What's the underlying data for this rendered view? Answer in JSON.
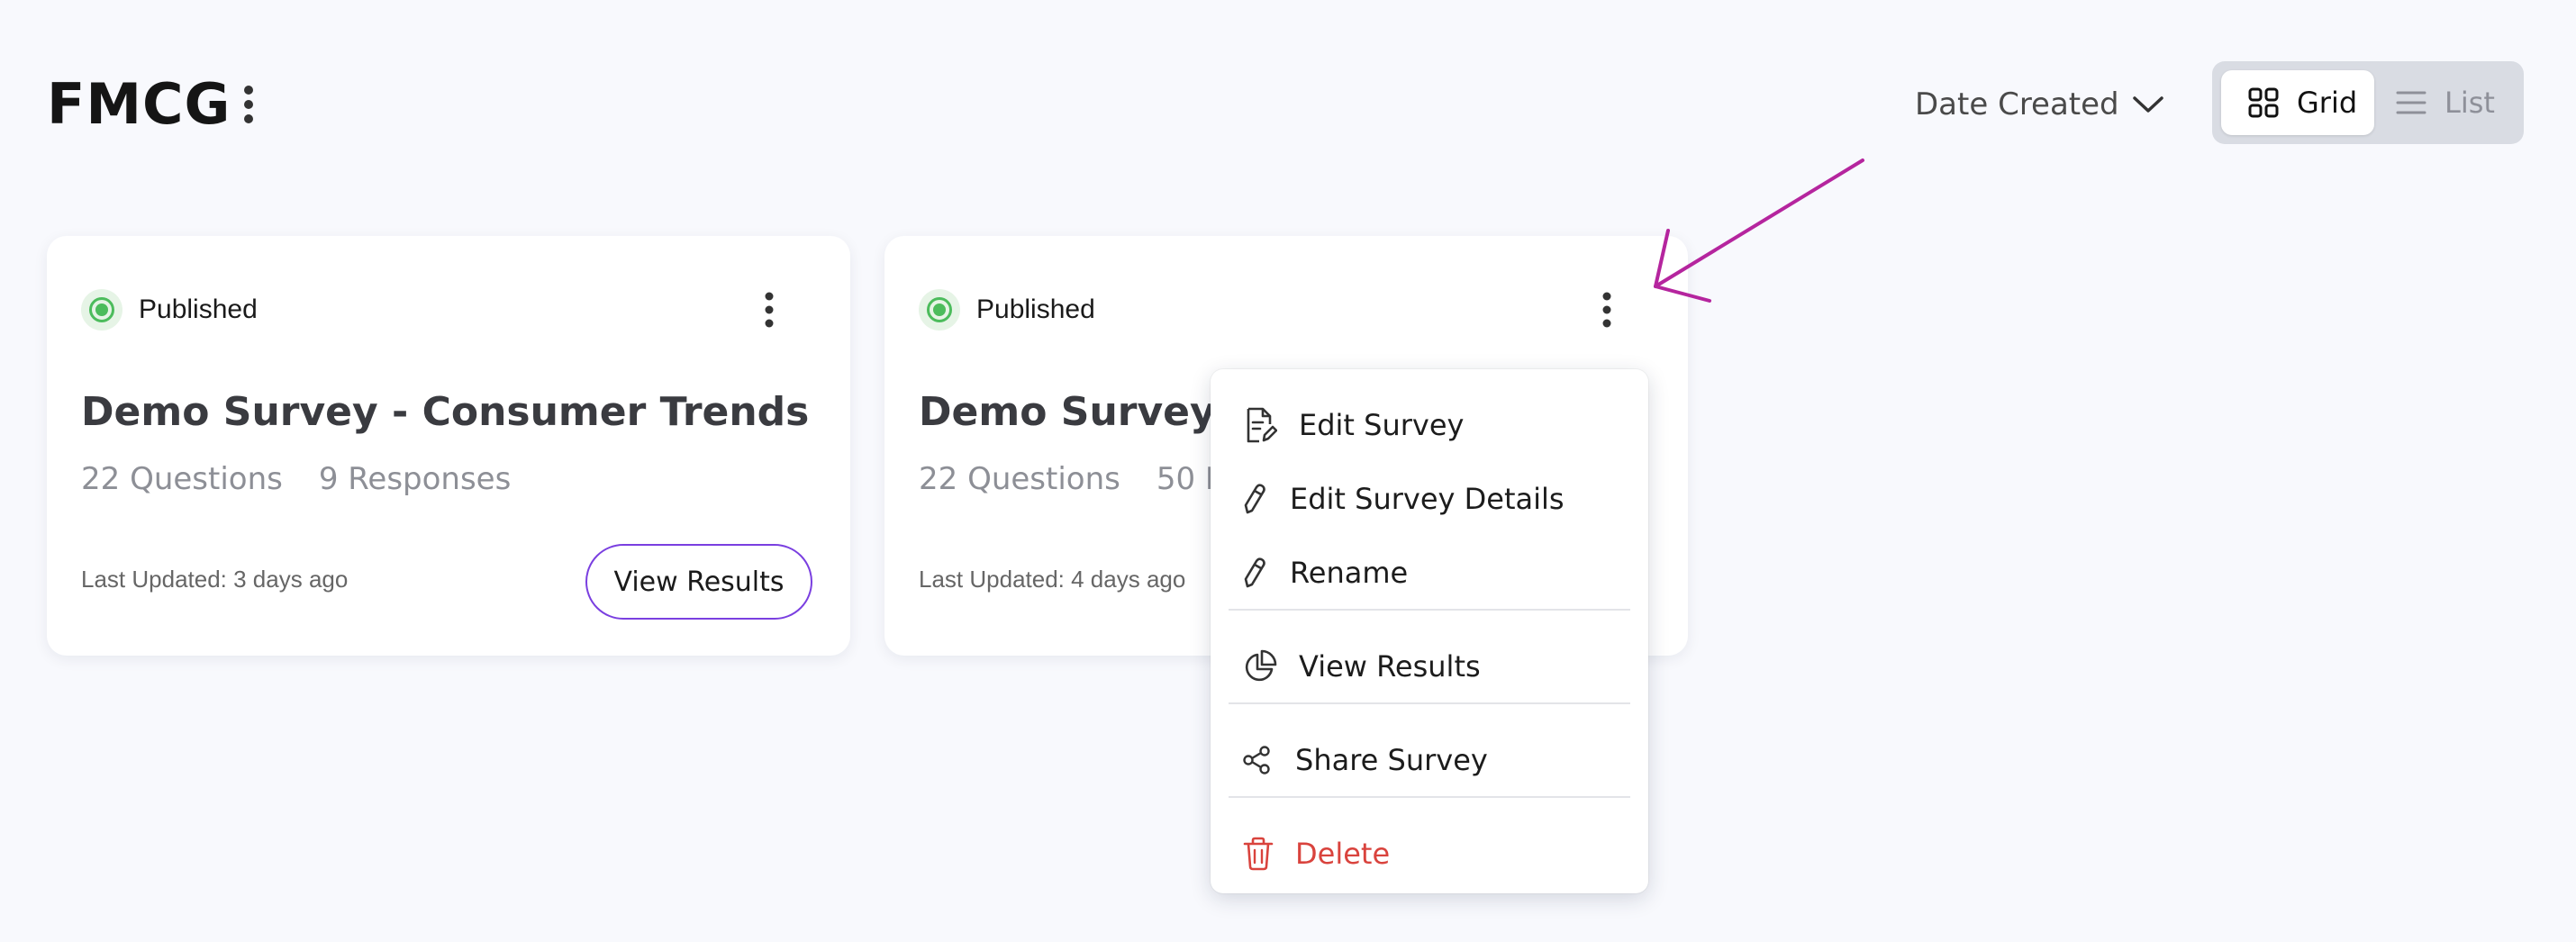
{
  "header": {
    "title": "FMCG",
    "sort_label": "Date Created",
    "view_toggle": {
      "grid_label": "Grid",
      "list_label": "List",
      "active": "grid"
    }
  },
  "cards": [
    {
      "status": "Published",
      "title": "Demo Survey - Consumer Trends",
      "questions": "22 Questions",
      "responses": "9 Responses",
      "updated": "Last Updated: 3 days ago",
      "button_label": "View Results"
    },
    {
      "status": "Published",
      "title": "Demo Survey - Consumer Trends",
      "questions": "22 Questions",
      "responses": "50 Responses",
      "updated": "Last Updated: 4 days ago"
    }
  ],
  "context_menu": {
    "edit_survey": "Edit Survey",
    "edit_details": "Edit Survey Details",
    "rename": "Rename",
    "view_results": "View Results",
    "share_survey": "Share Survey",
    "delete": "Delete"
  },
  "colors": {
    "accent": "#7a3fe0",
    "published": "#4cbc5c",
    "danger": "#d9433d",
    "annotation_arrow": "#b5259e"
  },
  "icons": {
    "title_menu": "kebab-icon",
    "sort": "chevron-down-icon",
    "grid": "grid-icon",
    "list": "list-icon",
    "edit_survey": "document-edit-icon",
    "edit_details": "pencil-icon",
    "rename": "pencil-icon",
    "view_results": "pie-chart-icon",
    "share": "share-icon",
    "delete": "trash-icon"
  }
}
